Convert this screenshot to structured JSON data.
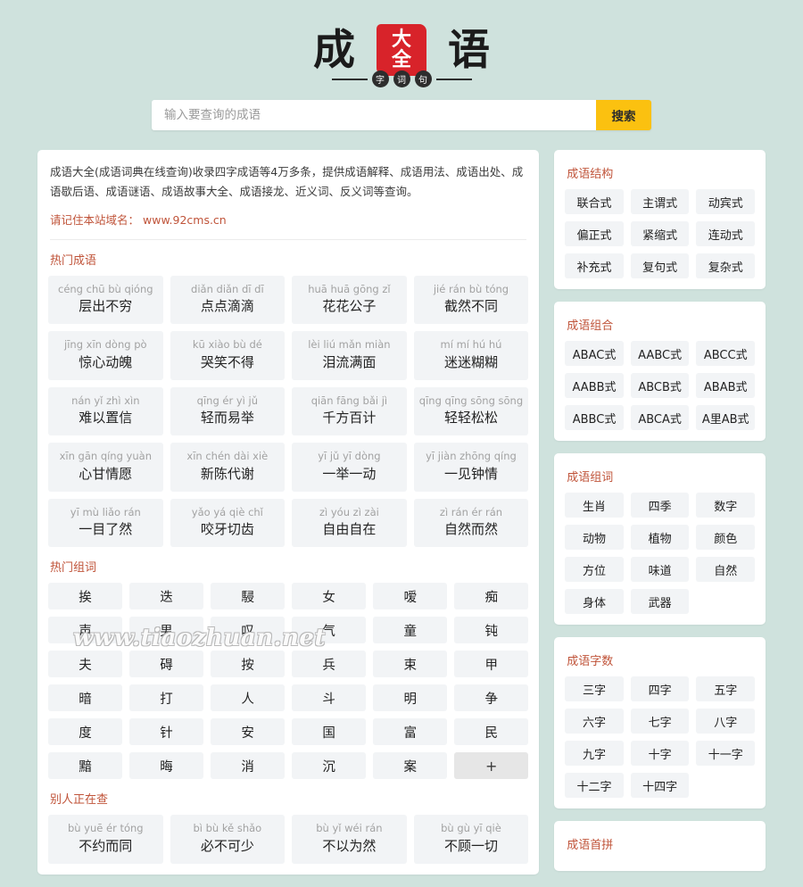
{
  "site": {
    "logo": {
      "left_char": "成",
      "right_char": "语",
      "seal_top": "大",
      "seal_bottom": "全",
      "sub_chars": [
        "字",
        "词",
        "句"
      ]
    }
  },
  "search": {
    "placeholder": "输入要查询的成语",
    "value": "",
    "button_label": "搜索"
  },
  "intro": {
    "text": "成语大全(成语词典在线查询)收录四字成语等4万多条，提供成语解释、成语用法、成语出处、成语歇后语、成语谜语、成语故事大全、成语接龙、近义词、反义词等查询。",
    "domain_prefix": "请记住本站域名：",
    "domain": "www.92cms.cn"
  },
  "watermark": "www.tiaozhuan.net",
  "sections": {
    "hot_idioms": {
      "title": "热门成语",
      "items": [
        {
          "pinyin": "céng chū bù qióng",
          "word": "层出不穷"
        },
        {
          "pinyin": "diǎn diǎn dī dī",
          "word": "点点滴滴"
        },
        {
          "pinyin": "huā huā gōng zǐ",
          "word": "花花公子"
        },
        {
          "pinyin": "jié rán bù tóng",
          "word": "截然不同"
        },
        {
          "pinyin": "jīng xīn dòng pò",
          "word": "惊心动魄"
        },
        {
          "pinyin": "kū xiào bù dé",
          "word": "哭笑不得"
        },
        {
          "pinyin": "lèi liú mǎn miàn",
          "word": "泪流满面"
        },
        {
          "pinyin": "mí mí hú hú",
          "word": "迷迷糊糊"
        },
        {
          "pinyin": "nán yǐ zhì xìn",
          "word": "难以置信"
        },
        {
          "pinyin": "qīng ér yì jǔ",
          "word": "轻而易举"
        },
        {
          "pinyin": "qiān fāng bǎi jì",
          "word": "千方百计"
        },
        {
          "pinyin": "qīng qīng sōng sōng",
          "word": "轻轻松松"
        },
        {
          "pinyin": "xīn gān qíng yuàn",
          "word": "心甘情愿"
        },
        {
          "pinyin": "xīn chén dài xiè",
          "word": "新陈代谢"
        },
        {
          "pinyin": "yī jǔ yī dòng",
          "word": "一举一动"
        },
        {
          "pinyin": "yī jiàn zhōng qíng",
          "word": "一见钟情"
        },
        {
          "pinyin": "yī mù liǎo rán",
          "word": "一目了然"
        },
        {
          "pinyin": "yǎo yá qiè chǐ",
          "word": "咬牙切齿"
        },
        {
          "pinyin": "zì yóu zì zài",
          "word": "自由自在"
        },
        {
          "pinyin": "zì rán ér rán",
          "word": "自然而然"
        }
      ]
    },
    "hot_words": {
      "title": "热门组词",
      "items": [
        "挨",
        "迭",
        "駸",
        "女",
        "嗳",
        "痴",
        "声",
        "男",
        "叹",
        "气",
        "童",
        "钝",
        "夫",
        "碍",
        "按",
        "兵",
        "束",
        "甲",
        "暗",
        "打",
        "人",
        "斗",
        "明",
        "争",
        "度",
        "针",
        "安",
        "国",
        "富",
        "民",
        "黯",
        "晦",
        "消",
        "沉",
        "案",
        "+"
      ],
      "more_label": "+"
    },
    "others_searching": {
      "title": "别人正在查",
      "items": [
        {
          "pinyin": "bù yuē ér tóng",
          "word": "不约而同"
        },
        {
          "pinyin": "bì bù kě shǎo",
          "word": "必不可少"
        },
        {
          "pinyin": "bù yǐ wéi rán",
          "word": "不以为然"
        },
        {
          "pinyin": "bù gù yī qiè",
          "word": "不顾一切"
        }
      ]
    }
  },
  "sidebar": {
    "structure": {
      "title": "成语结构",
      "items": [
        "联合式",
        "主谓式",
        "动宾式",
        "偏正式",
        "紧缩式",
        "连动式",
        "补充式",
        "复句式",
        "复杂式"
      ]
    },
    "combination": {
      "title": "成语组合",
      "items": [
        "ABAC式",
        "AABC式",
        "ABCC式",
        "AABB式",
        "ABCB式",
        "ABAB式",
        "ABBC式",
        "ABCA式",
        "A里AB式"
      ]
    },
    "wordgroup": {
      "title": "成语组词",
      "items": [
        "生肖",
        "四季",
        "数字",
        "动物",
        "植物",
        "颜色",
        "方位",
        "味道",
        "自然",
        "身体",
        "武器"
      ]
    },
    "charcount": {
      "title": "成语字数",
      "items": [
        "三字",
        "四字",
        "五字",
        "六字",
        "七字",
        "八字",
        "九字",
        "十字",
        "十一字",
        "十二字",
        "十四字"
      ]
    },
    "initials": {
      "title": "成语首拼"
    }
  },
  "colors": {
    "page_bg": "#cfe2dd",
    "heading": "#c0543a",
    "search_button": "#fbc110",
    "seal_red": "#d8232a",
    "tile_bg": "#f2f4f6"
  }
}
